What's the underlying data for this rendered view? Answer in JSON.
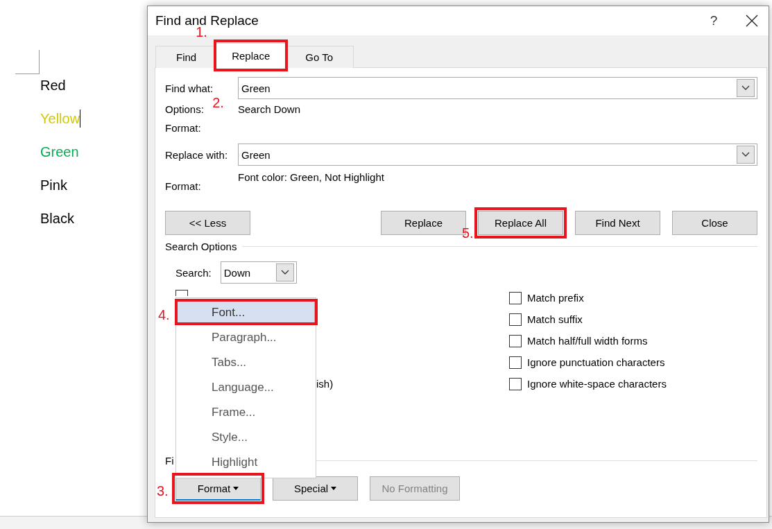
{
  "document": {
    "words": [
      {
        "text": "Red",
        "color": "#000000",
        "cursor": false
      },
      {
        "text": "Yellow",
        "color": "#d4c800",
        "cursor": true
      },
      {
        "text": "Green",
        "color": "#00b050",
        "cursor": false
      },
      {
        "text": "Pink",
        "color": "#000000",
        "cursor": false
      },
      {
        "text": "Black",
        "color": "#000000",
        "cursor": false
      }
    ]
  },
  "dialog": {
    "title": "Find and Replace",
    "help": "?",
    "tabs": [
      {
        "label": "Find",
        "selected": false
      },
      {
        "label": "Replace",
        "selected": true,
        "callout": {
          "number": "1.",
          "boxed": true
        }
      },
      {
        "label": "Go To",
        "selected": false
      }
    ],
    "find_what": {
      "label": "Find what:",
      "value": "Green"
    },
    "options": {
      "label": "Options:",
      "value": "Search Down",
      "callout": {
        "number": "2.",
        "boxed": false
      }
    },
    "find_format": {
      "label": "Format:"
    },
    "replace_with": {
      "label": "Replace with:",
      "value": "Green"
    },
    "replace_format": {
      "label": "Format:",
      "value": "Font color: Green, Not Highlight"
    },
    "buttons": [
      {
        "label": "<< Less"
      },
      {
        "label": "Replace"
      },
      {
        "label": "Replace All",
        "callout": {
          "number": "5.",
          "boxed": true
        }
      },
      {
        "label": "Find Next"
      },
      {
        "label": "Close"
      }
    ],
    "search_options": {
      "title": "Search Options",
      "search_label": "Search:",
      "search_value": "Down",
      "covered_checkbox": {
        "checked": false
      },
      "fragment": "ish)",
      "checkboxes": [
        {
          "label": "Match prefix",
          "checked": false
        },
        {
          "label": "Match suffix",
          "checked": false
        },
        {
          "label": "Match half/full width forms",
          "checked": false
        },
        {
          "label": "Ignore punctuation characters",
          "checked": false
        },
        {
          "label": "Ignore white-space characters",
          "checked": false
        }
      ]
    },
    "find_section_label": "Fi",
    "bottom_buttons": [
      {
        "label": "Format",
        "dropdown": true,
        "disabled": false,
        "callout": {
          "number": "3.",
          "boxed": true
        }
      },
      {
        "label": "Special",
        "dropdown": true,
        "disabled": false
      },
      {
        "label": "No Formatting",
        "dropdown": false,
        "disabled": true
      }
    ],
    "format_menu": {
      "items": [
        {
          "label": "Font...",
          "selected": true,
          "callout": {
            "number": "4.",
            "boxed": true
          }
        },
        {
          "label": "Paragraph...",
          "selected": false
        },
        {
          "label": "Tabs...",
          "selected": false
        },
        {
          "label": "Language...",
          "selected": false
        },
        {
          "label": "Frame...",
          "selected": false
        },
        {
          "label": "Style...",
          "selected": false
        },
        {
          "label": "Highlight",
          "selected": false
        }
      ]
    }
  }
}
